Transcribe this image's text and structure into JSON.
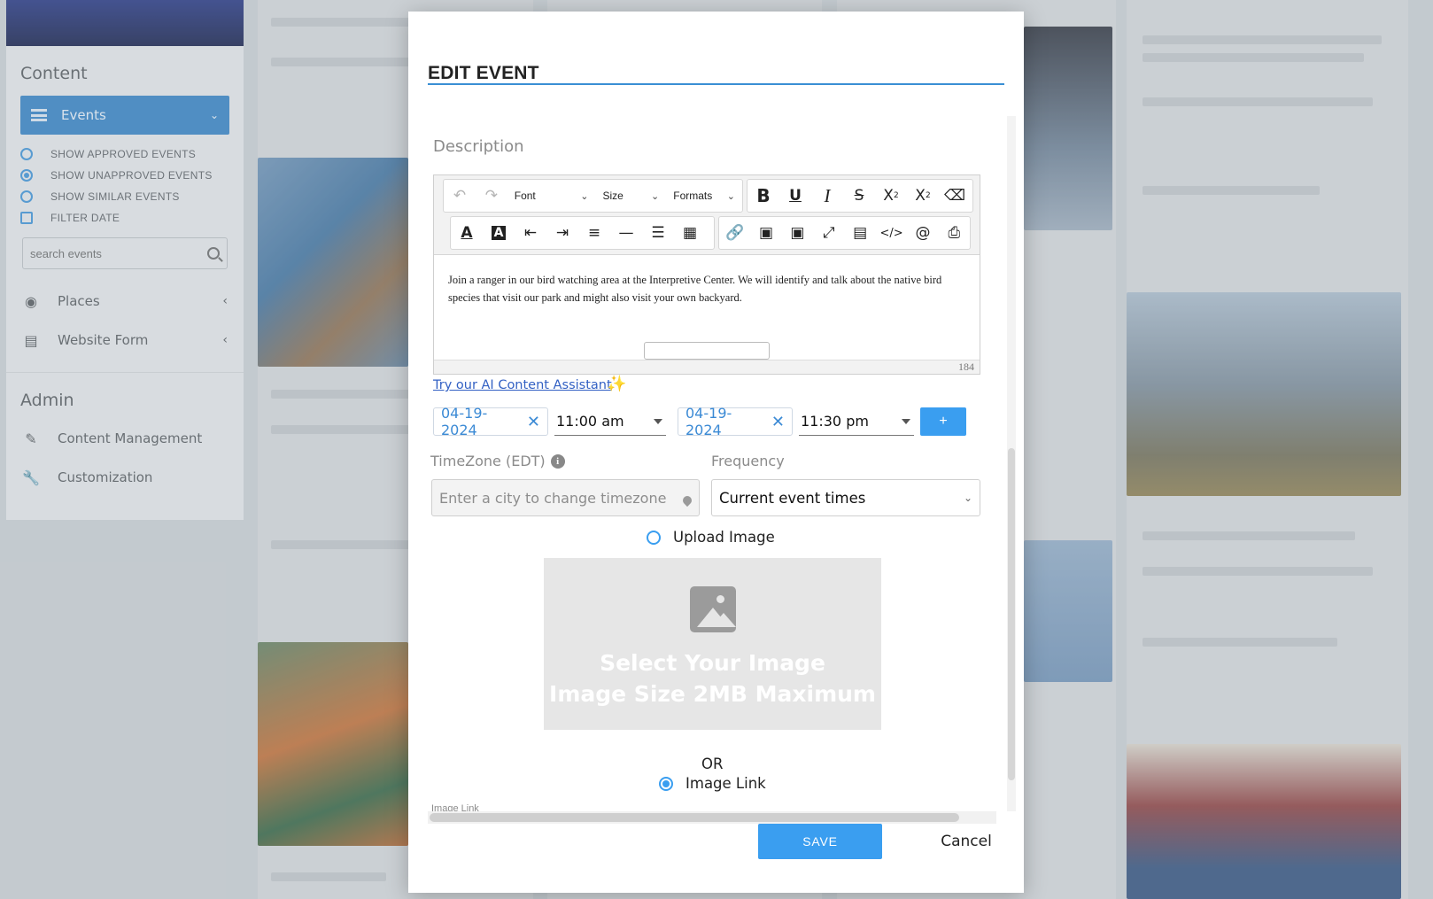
{
  "sidebar": {
    "banner": "",
    "content_heading": "Content",
    "events_label": "Events",
    "options": [
      {
        "label": "SHOW APPROVED EVENTS",
        "type": "radio",
        "checked": false
      },
      {
        "label": "SHOW UNAPPROVED EVENTS",
        "type": "radio",
        "checked": true
      },
      {
        "label": "SHOW SIMILAR EVENTS",
        "type": "radio",
        "checked": false
      },
      {
        "label": "FILTER DATE",
        "type": "checkbox",
        "checked": false
      }
    ],
    "search_placeholder": "search events",
    "nav": [
      {
        "label": "Places",
        "icon": "map-pin-icon"
      },
      {
        "label": "Website Form",
        "icon": "form-icon"
      }
    ],
    "admin_heading": "Admin",
    "admin_nav": [
      {
        "label": "Content Management",
        "icon": "pencil-icon"
      },
      {
        "label": "Customization",
        "icon": "wrench-icon"
      }
    ]
  },
  "modal": {
    "title": "EDIT EVENT",
    "description_label": "Description",
    "toolbar": {
      "font_label": "Font",
      "size_label": "Size",
      "formats_label": "Formats",
      "row1_buttons": [
        "undo-icon",
        "redo-icon",
        "bold-icon",
        "underline-icon",
        "italic-icon",
        "strikethrough-icon",
        "subscript-icon",
        "superscript-icon",
        "eraser-icon"
      ],
      "row2_buttons": [
        "text-color-icon",
        "highlight-icon",
        "outdent-icon",
        "indent-icon",
        "align-left-icon",
        "horizontal-rule-icon",
        "ordered-list-icon",
        "table-icon",
        "link-icon",
        "image-icon",
        "video-icon",
        "fullscreen-icon",
        "template-icon",
        "code-icon",
        "mention-icon",
        "print-icon"
      ]
    },
    "editor_text": "Join a ranger in our bird watching area at the Interpretive Center. We will identify and talk about the native bird species that visit our park and might also visit your own backyard.",
    "char_count": "184",
    "ai_link": "Try our AI Content Assistant",
    "start_date": "04-19-2024",
    "start_time": "11:00 am",
    "end_date": "04-19-2024",
    "end_time": "11:30 pm",
    "add_button": "+",
    "timezone_label": "TimeZone (EDT)",
    "timezone_placeholder": "Enter a city to change timezone",
    "frequency_label": "Frequency",
    "frequency_value": "Current event times",
    "upload_image_label": "Upload Image",
    "upload_selected": false,
    "drop_line1": "Select Your Image",
    "drop_line2": "Image Size 2MB Maximum",
    "or_text": "OR",
    "image_link_radio": "Image Link",
    "image_link_selected": true,
    "image_link_field_label": "Image Link",
    "save_label": "SAVE",
    "cancel_label": "Cancel"
  },
  "colors": {
    "accent": "#3a9ef0",
    "sidebar_active": "#2f7ec2",
    "title_rule": "#3a8fd4",
    "link": "#3361c4"
  }
}
